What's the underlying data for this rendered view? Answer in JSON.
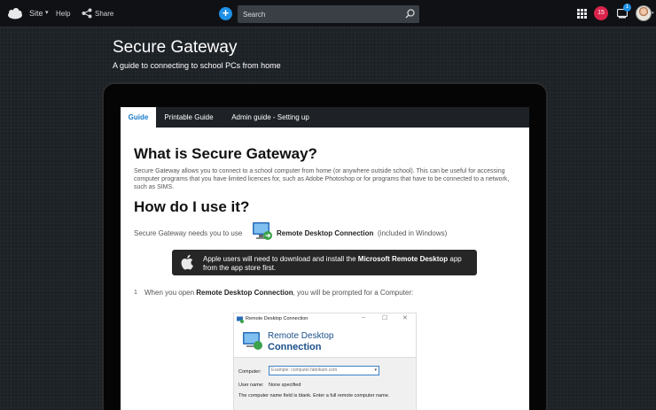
{
  "topbar": {
    "site_label": "Site",
    "site_caret": "▾",
    "help_label": "Help",
    "share_label": "Share",
    "add_label": "+",
    "search_placeholder": "Search",
    "notifications_count": "15",
    "messages_count": "1",
    "avatar_caret": "▾"
  },
  "header": {
    "title": "Secure Gateway",
    "subtitle": "A guide to connecting to school PCs from home"
  },
  "tabs": [
    {
      "label": "Guide",
      "active": true
    },
    {
      "label": "Printable Guide",
      "active": false
    },
    {
      "label": "Admin guide - Setting up",
      "active": false
    }
  ],
  "content": {
    "heading1": "What is Secure Gateway?",
    "intro": "Secure Gateway allows you to connect to a school computer from home (or anywhere outside school).  This can be useful for accessing computer programs that you have limited licences for, such as Adobe Photoshop or for programs that have to be connected to a network, such as SIMS.",
    "heading2": "How do I use it?",
    "needs_text": "Secure Gateway needs you to use",
    "rdc_name": "Remote Desktop Connection",
    "rdc_note": "(included in Windows)",
    "apple_prefix": "Apple users will need to download and install the ",
    "apple_app": "Microsoft Remote Desktop",
    "apple_suffix": " app from the app store first.",
    "step_number": "1",
    "step_prefix": "When you open ",
    "step_bold": "Remote Desktop Connection",
    "step_suffix": ", you will be prompted for a Computer:"
  },
  "dialog": {
    "title": "Remote Desktop Connection",
    "minimize": "–",
    "maximize": "☐",
    "close": "✕",
    "banner_line1": "Remote Desktop",
    "banner_line2": "Connection",
    "computer_label": "Computer:",
    "computer_placeholder": "Example: computer.fabrikam.com",
    "dropdown": "▾",
    "user_label": "User name:",
    "user_value": "None specified",
    "hint": "The computer name field is blank.  Enter a full remote computer name."
  },
  "colors": {
    "accent": "#1e90e6",
    "badge": "#d9234b",
    "tab_active_text": "#1a7bc8"
  }
}
